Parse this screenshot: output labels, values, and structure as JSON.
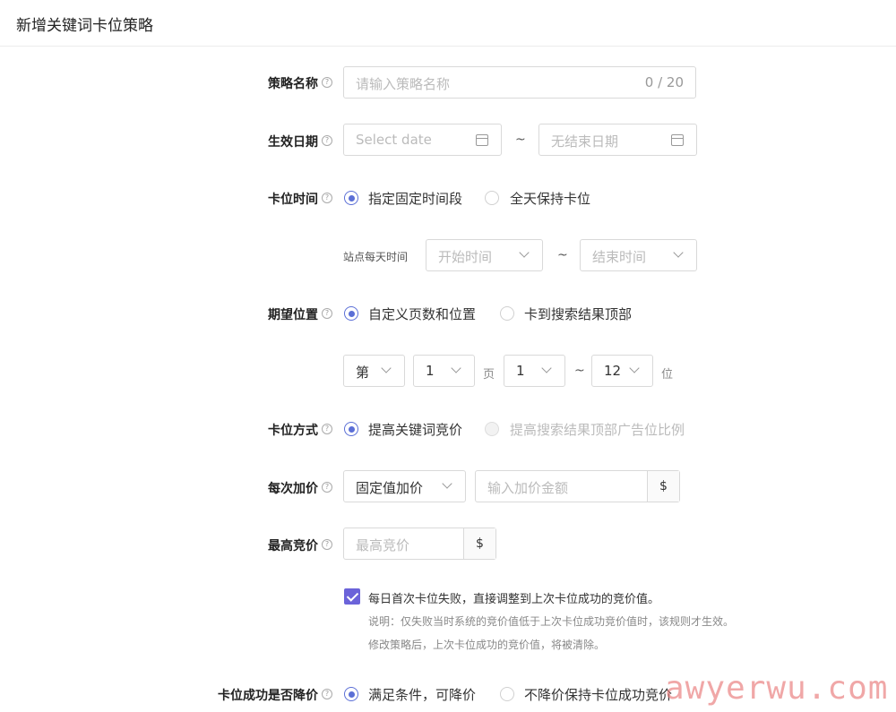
{
  "header": {
    "title": "新增关键词卡位策略"
  },
  "strategy_name": {
    "label": "策略名称",
    "placeholder": "请输入策略名称",
    "counter": "0 / 20"
  },
  "effective_date": {
    "label": "生效日期",
    "start_placeholder": "Select date",
    "separator": "~",
    "end_placeholder": "无结束日期"
  },
  "slot_time": {
    "label": "卡位时间",
    "options": [
      "指定固定时间段",
      "全天保持卡位"
    ],
    "selected": 0,
    "daily_label": "站点每天时间",
    "start_placeholder": "开始时间",
    "separator": "~",
    "end_placeholder": "结束时间"
  },
  "expected_position": {
    "label": "期望位置",
    "options": [
      "自定义页数和位置",
      "卡到搜索结果顶部"
    ],
    "selected": 0,
    "prefix_select": "第",
    "page_value": "1",
    "page_unit": "页",
    "pos_from": "1",
    "separator": "~",
    "pos_to": "12",
    "pos_unit": "位"
  },
  "slot_method": {
    "label": "卡位方式",
    "options": [
      "提高关键词竞价",
      "提高搜索结果顶部广告位比例"
    ],
    "selected": 0
  },
  "bid_increment": {
    "label": "每次加价",
    "mode": "固定值加价",
    "placeholder": "输入加价金额",
    "currency": "$"
  },
  "max_bid": {
    "label": "最高竞价",
    "placeholder": "最高竞价",
    "currency": "$"
  },
  "auto_adjust": {
    "checked": true,
    "text": "每日首次卡位失败，直接调整到上次卡位成功的竞价值。",
    "note1": "说明：仅失败当时系统的竞价值低于上次卡位成功竞价值时，该规则才生效。",
    "note2": "修改策略后，上次卡位成功的竞价值，将被清除。"
  },
  "lower_bid": {
    "label": "卡位成功是否降价",
    "options": [
      "满足条件，可降价",
      "不降价保持卡位成功竞价"
    ],
    "selected": 0
  },
  "watermark": "awyerwu.com",
  "colors": {
    "accent": "#5b6fd6",
    "checkbox": "#6b63d9"
  }
}
